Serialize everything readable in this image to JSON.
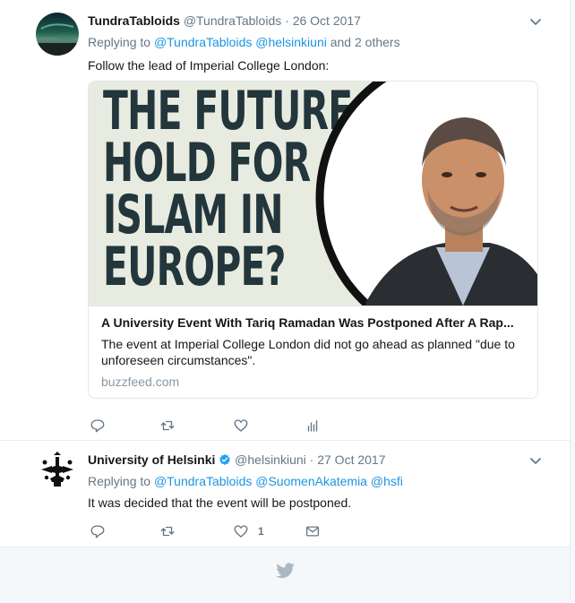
{
  "tweets": [
    {
      "name": "TundraTabloids",
      "handle": "@TundraTabloids",
      "separator": "·",
      "date": "26 Oct 2017",
      "replying_prefix": "Replying to",
      "reply_to": [
        "@TundraTabloids",
        "@helsinkiuni"
      ],
      "reply_suffix": "and 2 others",
      "text": "Follow the lead of Imperial College London:",
      "card": {
        "image_headline": "THE FUTURE\nHOLD FOR\nISLAM IN\nEUROPE?",
        "title": "A University Event With Tariq Ramadan Was Postponed After A Rap...",
        "description": "The event at Imperial College London did not go ahead as planned \"due to unforeseen circumstances\".",
        "domain": "buzzfeed.com"
      },
      "actions": {
        "reply_icon": "reply-icon",
        "retweet_icon": "retweet-icon",
        "like_icon": "heart-icon",
        "analytics_icon": "analytics-icon"
      }
    },
    {
      "name": "University of Helsinki",
      "verified_icon": "verified-badge-icon",
      "handle": "@helsinkiuni",
      "separator": "·",
      "date": "27 Oct 2017",
      "replying_prefix": "Replying to",
      "reply_to": [
        "@TundraTabloids",
        "@SuomenAkatemia",
        "@hsfi"
      ],
      "text": "It was decided that the event will be postponed.",
      "actions": {
        "reply_icon": "reply-icon",
        "retweet_icon": "retweet-icon",
        "like_icon": "heart-icon",
        "like_count": "1",
        "dm_icon": "envelope-icon"
      }
    }
  ],
  "footer": {
    "icon": "twitter-bird-icon"
  },
  "colors": {
    "link": "#1b95e0",
    "muted": "#657786",
    "verified": "#1da1f2",
    "border": "#e6ecf0"
  }
}
